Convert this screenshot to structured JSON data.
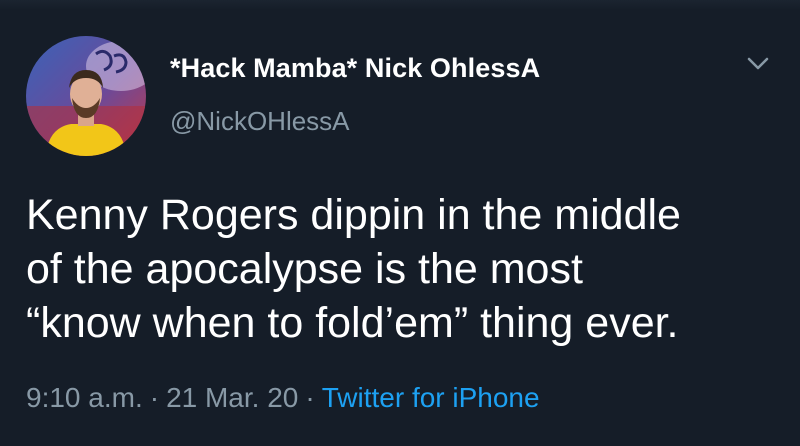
{
  "tweet": {
    "author": {
      "display_name": "*Hack Mamba* Nick OhlessA",
      "handle": "@NickOHlessA"
    },
    "text": "Kenny Rogers dippin in the middle\nof the apocalypse is the most\n“know when to fold’em” thing ever.",
    "meta": {
      "time": "9:10 a.m.",
      "separator": "·",
      "date": "21 Mar. 20",
      "source": "Twitter for iPhone"
    },
    "more_icon": "chevron-down-icon"
  },
  "colors": {
    "background": "#151d28",
    "text": "#ffffff",
    "muted": "#8899a6",
    "link": "#1da1f2",
    "avatar_shirt": "#f2c618"
  }
}
